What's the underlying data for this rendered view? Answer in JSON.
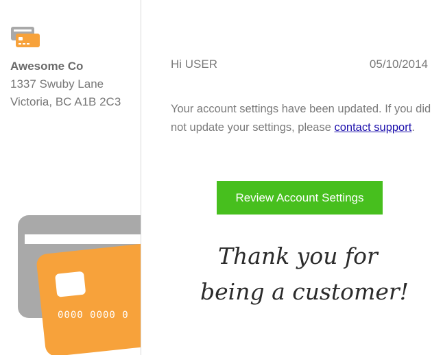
{
  "company": {
    "name": "Awesome Co",
    "address_line1": "1337 Swuby Lane",
    "address_line2": "Victoria, BC A1B 2C3"
  },
  "illustration": {
    "card_number": "0000 0000 0"
  },
  "email": {
    "greeting": "Hi USER",
    "date": "05/10/2014",
    "message_pre": "Your account settings have been updated. If you did not update your settings, please ",
    "link_text": "contact support",
    "message_post": "."
  },
  "cta": {
    "label": "Review Account Settings",
    "color": "#47bf1e"
  },
  "signoff": {
    "line1": "Thank you for",
    "line2": "being a customer!"
  },
  "colors": {
    "accent_orange": "#f7a23b",
    "card_gray": "#a9a9a9",
    "link_blue": "#1a0dab"
  }
}
